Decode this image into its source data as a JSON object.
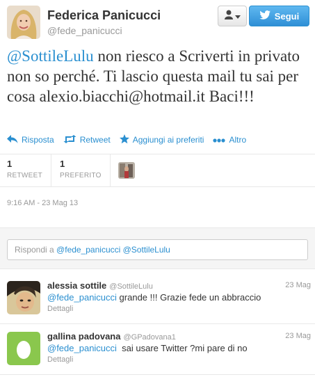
{
  "profile": {
    "name": "Federica Panicucci",
    "handle": "@fede_panicucci",
    "follow_label": "Segui"
  },
  "tweet": {
    "mention": "@SottileLulu",
    "text": " non riesco a Scriverti in privato non so perché. Ti lascio questa mail tu sai per cosa alexio.biacchi@hotmail.it Baci!!!"
  },
  "actions": {
    "reply": "Risposta",
    "retweet": "Retweet",
    "favorite": "Aggiungi ai preferiti",
    "more": "Altro"
  },
  "stats": {
    "retweets_count": "1",
    "retweets_label": "RETWEET",
    "favorites_count": "1",
    "favorites_label": "PREFERITO"
  },
  "timestamp": "9:16 AM - 23 Mag 13",
  "reply_box": {
    "prefix": "Rispondi a ",
    "mentions": "@fede_panicucci @SottileLulu"
  },
  "replies": [
    {
      "name": "alessia sottile",
      "handle": "@SottileLulu",
      "date": "23 Mag",
      "mention": "@fede_panicucci",
      "text": " grande !!! Grazie fede un abbraccio",
      "details": "Dettagli"
    },
    {
      "name": "gallina padovana",
      "handle": "@GPadovana1",
      "date": "23 Mag",
      "mention": "@fede_panicucci",
      "text": "  sai usare Twitter ?mi pare di no",
      "details": "Dettagli"
    }
  ],
  "colors": {
    "link": "#2a8fd0",
    "follow_button": "#2f8fd6"
  }
}
